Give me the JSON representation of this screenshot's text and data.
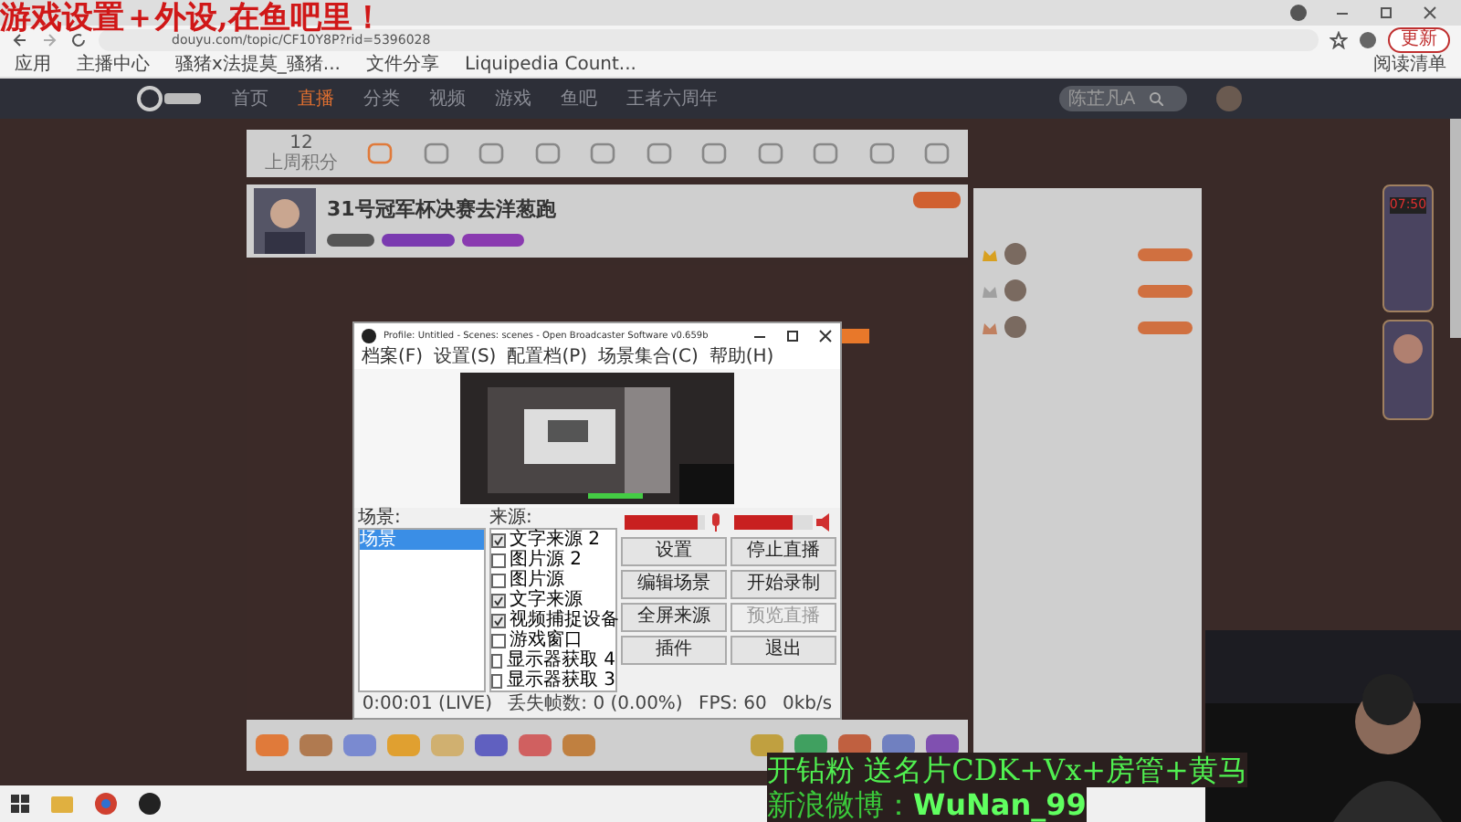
{
  "overlay_caption": "游戏设置＋外设,在鱼吧里！",
  "browser": {
    "url": "douyu.com/topic/CF10Y8P?rid=5396028",
    "update_button": "更新",
    "bookmarks": [
      "应用",
      "主播中心",
      "骚猪x法提莫_骚猪...",
      "文件分享",
      "Liquipedia Count..."
    ],
    "reading_list": "阅读清单"
  },
  "site_nav": {
    "items": [
      {
        "label": "首页",
        "selected": false
      },
      {
        "label": "直播",
        "selected": true
      },
      {
        "label": "分类",
        "selected": false
      },
      {
        "label": "视频",
        "selected": false
      },
      {
        "label": "游戏",
        "selected": false
      },
      {
        "label": "鱼吧",
        "selected": false
      },
      {
        "label": "王者六周年",
        "selected": false
      }
    ],
    "search": {
      "placeholder": "陈芷凡A"
    }
  },
  "room": {
    "score": "12",
    "score_label": "上周积分",
    "title": "31号冠军杯决赛去洋葱跑",
    "timer": "07:50"
  },
  "obs": {
    "title": "Profile: Untitled - Scenes: scenes - Open Broadcaster Software v0.659b",
    "menu": [
      "档案(F)",
      "设置(S)",
      "配置档(P)",
      "场景集合(C)",
      "帮助(H)"
    ],
    "scenes_label": "场景:",
    "scenes": [
      {
        "label": "场景",
        "selected": true
      }
    ],
    "sources_label": "来源:",
    "sources": [
      {
        "label": "文字来源 2",
        "checked": true
      },
      {
        "label": "图片源 2",
        "checked": false
      },
      {
        "label": "图片源",
        "checked": false
      },
      {
        "label": "文字来源",
        "checked": true
      },
      {
        "label": "视频捕捉设备",
        "checked": true
      },
      {
        "label": "游戏窗口",
        "checked": false
      },
      {
        "label": "显示器获取 4",
        "checked": false
      },
      {
        "label": "显示器获取 3",
        "checked": false
      }
    ],
    "meters": [
      {
        "kind": "mic",
        "level": 0.9
      },
      {
        "kind": "speaker",
        "level": 0.75
      }
    ],
    "buttons": [
      {
        "label": "设置",
        "disabled": false
      },
      {
        "label": "停止直播",
        "disabled": false
      },
      {
        "label": "编辑场景",
        "disabled": false
      },
      {
        "label": "开始录制",
        "disabled": false
      },
      {
        "label": "全屏来源",
        "disabled": false
      },
      {
        "label": "预览直播",
        "disabled": true
      },
      {
        "label": "插件",
        "disabled": false
      },
      {
        "label": "退出",
        "disabled": false
      }
    ],
    "status": [
      "0:00:01 (LIVE)",
      "丢失帧数: 0 (0.00%)",
      "FPS: 60",
      "0kb/s"
    ]
  },
  "promo": [
    "开钻粉 送名片CDK+Vx+房管+黄马",
    "新浪微博：**WuNan_99**"
  ]
}
